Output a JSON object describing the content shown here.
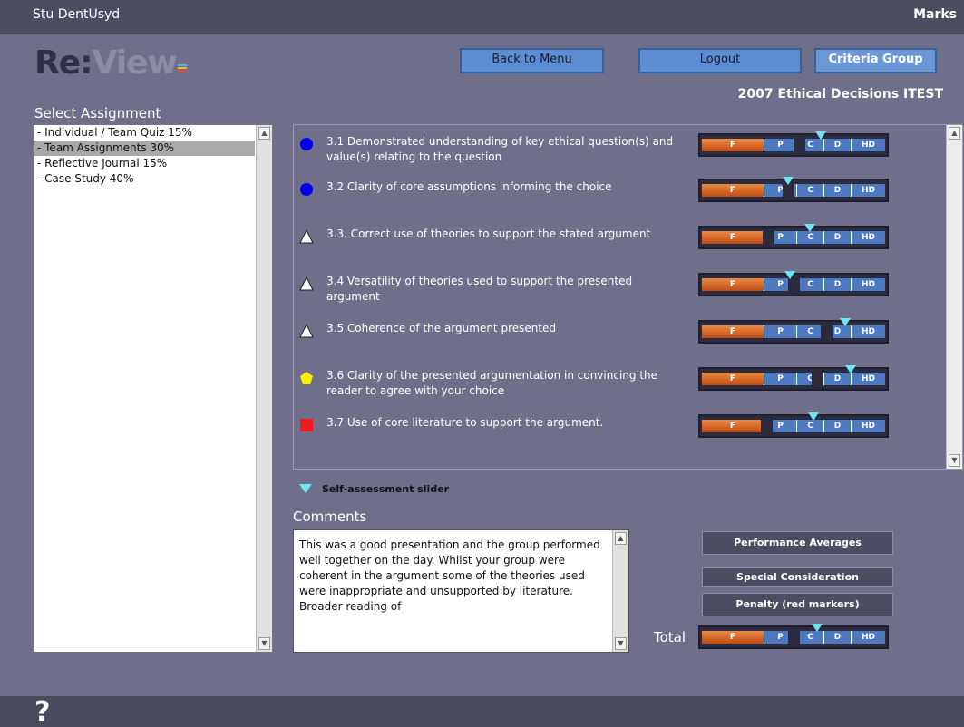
{
  "header": {
    "user": "Stu DentUsyd",
    "section": "Marks"
  },
  "logo": {
    "part1": "Re",
    "colon": ":",
    "part2": "View",
    "dash_colors": [
      "#4fb3e3",
      "#f6b72f",
      "#e34c32"
    ]
  },
  "nav": {
    "back": "Back to Menu",
    "logout": "Logout",
    "criteria": "Criteria Group"
  },
  "assessment_title": "2007 Ethical Decisions ITEST",
  "sidebar": {
    "label": "Select Assignment",
    "items": [
      {
        "label": "- Individual / Team Quiz 15%",
        "selected": false
      },
      {
        "label": "- Team Assignments 30%",
        "selected": true
      },
      {
        "label": "- Reflective Journal 15%",
        "selected": false
      },
      {
        "label": "- Case Study 40%",
        "selected": false
      }
    ]
  },
  "scale_labels": [
    "F",
    "P",
    "C",
    "D",
    "HD"
  ],
  "criteria": [
    {
      "text": "3.1 Demonstrated understanding of key ethical question(s) and value(s) relating to the question",
      "marker": "circle",
      "color": "#0000ee",
      "level": 0.53,
      "self": 0.65
    },
    {
      "text": "3.2 Clarity of core assumptions informing the choice",
      "marker": "circle",
      "color": "#0000ee",
      "level": 0.47,
      "self": 0.47
    },
    {
      "text": "3.3. Correct use of theories to support the stated argument",
      "marker": "triangle",
      "color": "#ffffff",
      "level": 0.36,
      "self": 0.59
    },
    {
      "text": "3.4 Versatility of theories used to support the presented argument",
      "marker": "triangle",
      "color": "#ffffff",
      "level": 0.5,
      "self": 0.48
    },
    {
      "text": "3.5 Coherence of the argument presented",
      "marker": "triangle",
      "color": "#ffffff",
      "level": 0.68,
      "self": 0.78
    },
    {
      "text": "3.6 Clarity of the presented argumentation in convincing the reader to agree with your choice",
      "marker": "pentagon",
      "color": "#ffee00",
      "level": 0.63,
      "self": 0.81
    },
    {
      "text": "3.7 Use of core literature to support the argument.",
      "marker": "square",
      "color": "#ee1c1c",
      "level": 0.35,
      "self": 0.61
    }
  ],
  "legend": {
    "self_assessment": "Self-assessment slider"
  },
  "comments": {
    "label": "Comments",
    "text": "This was a good presentation and the group performed well together on the day. Whilst your group were coherent in the argument some of the theories used were inappropriate and unsupported by literature. Broader reading of"
  },
  "side_buttons": {
    "averages": "Performance Averages",
    "special": "Special Consideration",
    "penalty": "Penalty (red markers)"
  },
  "total": {
    "label": "Total",
    "level": 0.5,
    "self": 0.63
  },
  "help": "?"
}
